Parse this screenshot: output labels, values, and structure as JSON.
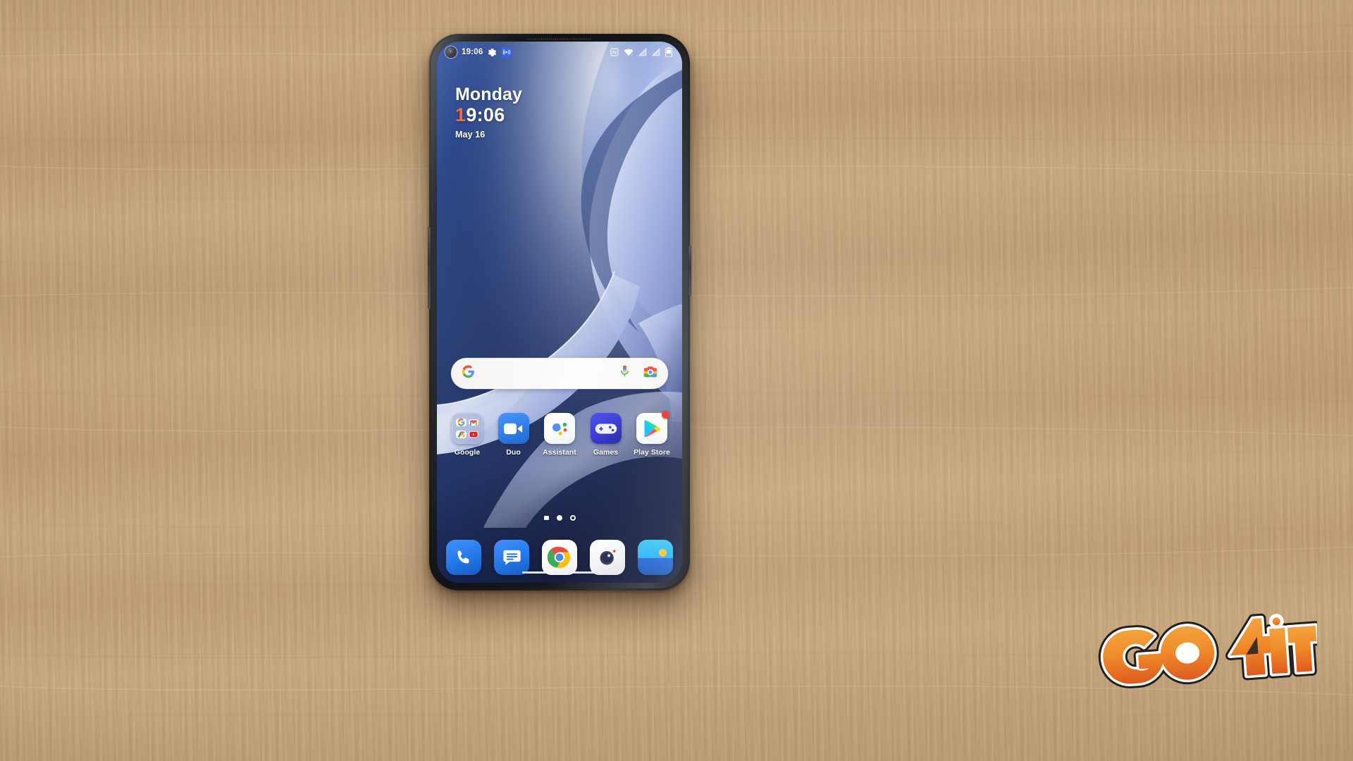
{
  "scene": {
    "subject": "smartphone on wooden desk",
    "background": "light oak wood grain",
    "wood_color": "#c2a178"
  },
  "phone": {
    "frame_color": "#15171b",
    "hardware": {
      "earpiece": "earpiece-speaker-grille",
      "front_camera": "punch-hole-front-camera",
      "volume_button": "volume-rocker",
      "power_button": "power-button"
    }
  },
  "statusbar": {
    "time": "19:06",
    "left_icons": [
      "settings-gear-icon",
      "nfc-beam-icon"
    ],
    "right_icons": [
      "nfc-icon",
      "wifi-icon",
      "sim1-no-signal-icon",
      "sim2-no-signal-icon",
      "battery-icon"
    ],
    "accent": "#2a5cf0"
  },
  "clock_widget": {
    "day": "Monday",
    "time_first_digit": "1",
    "time_rest": "9:06",
    "date": "May 16",
    "highlight_color": "#ff5a1f"
  },
  "search": {
    "placeholder": "",
    "value": "",
    "logo": "google-g-logo",
    "mic_label": "voice-search",
    "lens_label": "google-lens",
    "bar_color": "#f7f7f6"
  },
  "app_grid": [
    {
      "label": "Google",
      "icon": "google-folder-icon",
      "type": "folder",
      "contents": [
        "google-search-icon",
        "gmail-icon",
        "maps-icon",
        "youtube-icon"
      ]
    },
    {
      "label": "Duo",
      "icon": "duo-icon",
      "type": "app",
      "color": "#1a73e8"
    },
    {
      "label": "Assistant",
      "icon": "google-assistant-icon",
      "type": "app",
      "color": "#ffffff"
    },
    {
      "label": "Games",
      "icon": "games-gamepad-icon",
      "type": "app",
      "color": "#2d2fd6"
    },
    {
      "label": "Play Store",
      "icon": "play-store-icon",
      "type": "app",
      "color": "#ffffff",
      "badge": "notification-dot"
    }
  ],
  "page_indicator": {
    "pages": [
      "widgets-page",
      "home-page-current",
      "home-page-2"
    ],
    "current_index": 1
  },
  "dock": [
    {
      "label": "Phone",
      "icon": "phone-icon",
      "color": "#1a73e8"
    },
    {
      "label": "Messages",
      "icon": "messages-icon",
      "color": "#1a73e8"
    },
    {
      "label": "Chrome",
      "icon": "chrome-icon",
      "color": "#ffffff"
    },
    {
      "label": "Camera",
      "icon": "camera-icon",
      "color": "#f1f2f4"
    },
    {
      "label": "Photos",
      "icon": "gallery-icon",
      "color": "#21a7f0"
    }
  ],
  "navigation": {
    "type": "gesture-pill"
  },
  "watermark": {
    "text_go": "GO",
    "text_4": "4",
    "text_it": "iT",
    "full_text": "GO4iT",
    "color_light": "#f0962f",
    "color_dark": "#e2581f"
  }
}
